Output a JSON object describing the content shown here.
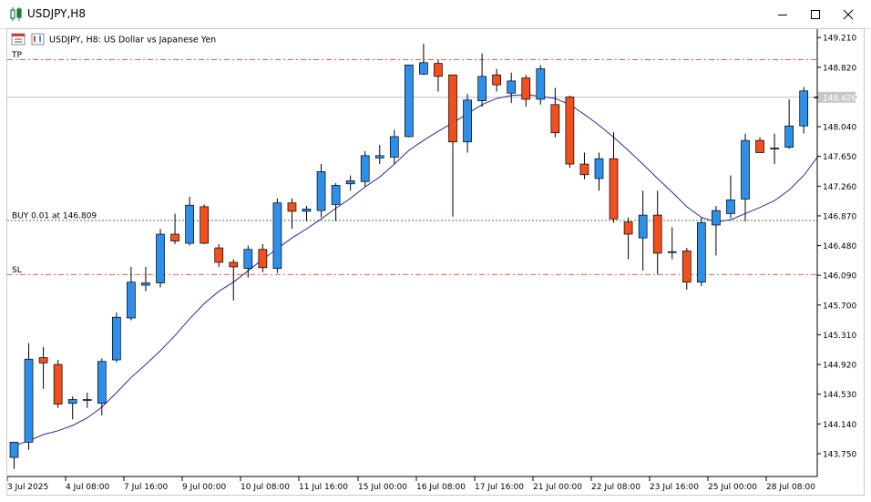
{
  "window": {
    "title": "USDJPY,H8"
  },
  "chart_header": {
    "text": "USDJPY, H8:  US Dollar vs Japanese Yen"
  },
  "lines": {
    "tp_label": "TP",
    "buy_label": "BUY 0.01 at 146.809",
    "sl_label": "SL",
    "tp_price": 148.92,
    "buy_price": 146.809,
    "sl_price": 146.1,
    "current_price_label": "148.426",
    "current_price": 148.426
  },
  "colors": {
    "bull": "#2e8fea",
    "bear": "#f0501e",
    "ma": "#2a2a9a",
    "tp_sl_line": "#e8623a",
    "buy_line": "#3a8a3a",
    "price_line": "#c0c0c0",
    "price_tag_bg": "#c8c8c8"
  },
  "chart_data": {
    "type": "candlestick",
    "symbol": "USDJPY",
    "timeframe": "H8",
    "ylim": [
      143.45,
      149.32
    ],
    "y_ticks": [
      "149.210",
      "148.820",
      "148.430",
      "148.040",
      "147.650",
      "147.260",
      "146.870",
      "146.480",
      "146.090",
      "145.700",
      "145.310",
      "144.920",
      "144.530",
      "144.140",
      "143.750"
    ],
    "x_ticks": [
      "3 Jul 2025",
      "4 Jul 08:00",
      "7 Jul 16:00",
      "9 Jul 00:00",
      "10 Jul 08:00",
      "11 Jul 16:00",
      "15 Jul 00:00",
      "16 Jul 08:00",
      "17 Jul 16:00",
      "21 Jul 00:00",
      "22 Jul 08:00",
      "23 Jul 16:00",
      "25 Jul 00:00",
      "28 Jul 08:00"
    ],
    "candles": [
      {
        "o": 143.7,
        "h": 143.9,
        "l": 143.55,
        "c": 143.9
      },
      {
        "o": 143.9,
        "h": 145.2,
        "l": 143.8,
        "c": 144.99
      },
      {
        "o": 145.01,
        "h": 145.15,
        "l": 144.6,
        "c": 144.94
      },
      {
        "o": 144.92,
        "h": 144.98,
        "l": 144.35,
        "c": 144.4
      },
      {
        "o": 144.41,
        "h": 144.5,
        "l": 144.2,
        "c": 144.46
      },
      {
        "o": 144.45,
        "h": 144.55,
        "l": 144.35,
        "c": 144.46
      },
      {
        "o": 144.41,
        "h": 145.0,
        "l": 144.25,
        "c": 144.96
      },
      {
        "o": 144.98,
        "h": 145.6,
        "l": 144.95,
        "c": 145.54
      },
      {
        "o": 145.53,
        "h": 146.2,
        "l": 145.5,
        "c": 146.0
      },
      {
        "o": 145.96,
        "h": 146.2,
        "l": 145.88,
        "c": 145.99
      },
      {
        "o": 145.99,
        "h": 146.7,
        "l": 145.93,
        "c": 146.63
      },
      {
        "o": 146.63,
        "h": 146.9,
        "l": 146.5,
        "c": 146.54
      },
      {
        "o": 146.51,
        "h": 147.12,
        "l": 146.48,
        "c": 147.01
      },
      {
        "o": 146.99,
        "h": 147.02,
        "l": 146.5,
        "c": 146.51
      },
      {
        "o": 146.45,
        "h": 146.5,
        "l": 146.2,
        "c": 146.26
      },
      {
        "o": 146.26,
        "h": 146.3,
        "l": 145.76,
        "c": 146.2
      },
      {
        "o": 146.18,
        "h": 146.48,
        "l": 146.06,
        "c": 146.43
      },
      {
        "o": 146.43,
        "h": 146.5,
        "l": 146.13,
        "c": 146.19
      },
      {
        "o": 146.18,
        "h": 147.1,
        "l": 146.12,
        "c": 147.04
      },
      {
        "o": 147.04,
        "h": 147.1,
        "l": 146.7,
        "c": 146.93
      },
      {
        "o": 146.93,
        "h": 147.0,
        "l": 146.8,
        "c": 146.96
      },
      {
        "o": 146.94,
        "h": 147.55,
        "l": 146.85,
        "c": 147.45
      },
      {
        "o": 147.02,
        "h": 147.3,
        "l": 146.8,
        "c": 147.27
      },
      {
        "o": 147.29,
        "h": 147.4,
        "l": 147.2,
        "c": 147.33
      },
      {
        "o": 147.32,
        "h": 147.72,
        "l": 147.25,
        "c": 147.66
      },
      {
        "o": 147.63,
        "h": 147.8,
        "l": 147.55,
        "c": 147.66
      },
      {
        "o": 147.64,
        "h": 148.0,
        "l": 147.55,
        "c": 147.91
      },
      {
        "o": 147.91,
        "h": 148.54,
        "l": 147.9,
        "c": 148.85
      },
      {
        "o": 148.73,
        "h": 149.13,
        "l": 148.72,
        "c": 148.88
      },
      {
        "o": 148.87,
        "h": 148.92,
        "l": 148.5,
        "c": 148.7
      },
      {
        "o": 148.72,
        "h": 148.72,
        "l": 146.86,
        "c": 147.84
      },
      {
        "o": 147.84,
        "h": 148.47,
        "l": 147.7,
        "c": 148.39
      },
      {
        "o": 148.38,
        "h": 149.0,
        "l": 148.3,
        "c": 148.7
      },
      {
        "o": 148.72,
        "h": 148.8,
        "l": 148.5,
        "c": 148.59
      },
      {
        "o": 148.48,
        "h": 148.75,
        "l": 148.35,
        "c": 148.64
      },
      {
        "o": 148.68,
        "h": 148.72,
        "l": 148.3,
        "c": 148.4
      },
      {
        "o": 148.4,
        "h": 148.85,
        "l": 148.33,
        "c": 148.8
      },
      {
        "o": 148.33,
        "h": 148.55,
        "l": 147.9,
        "c": 147.96
      },
      {
        "o": 148.43,
        "h": 148.45,
        "l": 147.5,
        "c": 147.55
      },
      {
        "o": 147.55,
        "h": 147.7,
        "l": 147.35,
        "c": 147.41
      },
      {
        "o": 147.36,
        "h": 147.7,
        "l": 147.2,
        "c": 147.62
      },
      {
        "o": 147.62,
        "h": 147.97,
        "l": 146.78,
        "c": 146.83
      },
      {
        "o": 146.79,
        "h": 146.85,
        "l": 146.3,
        "c": 146.63
      },
      {
        "o": 146.58,
        "h": 147.2,
        "l": 146.15,
        "c": 146.88
      },
      {
        "o": 146.88,
        "h": 147.2,
        "l": 146.1,
        "c": 146.38
      },
      {
        "o": 146.4,
        "h": 146.72,
        "l": 146.3,
        "c": 146.4
      },
      {
        "o": 146.41,
        "h": 146.45,
        "l": 145.9,
        "c": 146.0
      },
      {
        "o": 146.0,
        "h": 146.85,
        "l": 145.95,
        "c": 146.78
      },
      {
        "o": 146.75,
        "h": 147.0,
        "l": 146.35,
        "c": 146.94
      },
      {
        "o": 146.9,
        "h": 147.4,
        "l": 146.84,
        "c": 147.08
      },
      {
        "o": 147.09,
        "h": 147.95,
        "l": 146.8,
        "c": 147.86
      },
      {
        "o": 147.86,
        "h": 147.9,
        "l": 147.7,
        "c": 147.7
      },
      {
        "o": 147.75,
        "h": 147.95,
        "l": 147.55,
        "c": 147.76
      },
      {
        "o": 147.77,
        "h": 148.4,
        "l": 147.75,
        "c": 148.05
      },
      {
        "o": 148.05,
        "h": 148.56,
        "l": 147.95,
        "c": 148.51
      },
      {
        "o": 148.43,
        "h": 148.43,
        "l": 148.43,
        "c": 148.43
      }
    ],
    "ma": [
      143.85,
      143.92,
      144.0,
      144.05,
      144.12,
      144.22,
      144.36,
      144.55,
      144.75,
      144.92,
      145.1,
      145.3,
      145.52,
      145.72,
      145.88,
      146.0,
      146.15,
      146.3,
      146.44,
      146.58,
      146.7,
      146.83,
      146.97,
      147.1,
      147.25,
      147.38,
      147.55,
      147.73,
      147.86,
      147.98,
      148.09,
      148.21,
      148.33,
      148.41,
      148.45,
      148.46,
      148.44,
      148.41,
      148.33,
      148.2,
      148.06,
      147.9,
      147.73,
      147.55,
      147.36,
      147.18,
      146.99,
      146.85,
      146.79,
      146.82,
      146.9,
      146.98,
      147.07,
      147.21,
      147.4,
      147.66
    ]
  }
}
